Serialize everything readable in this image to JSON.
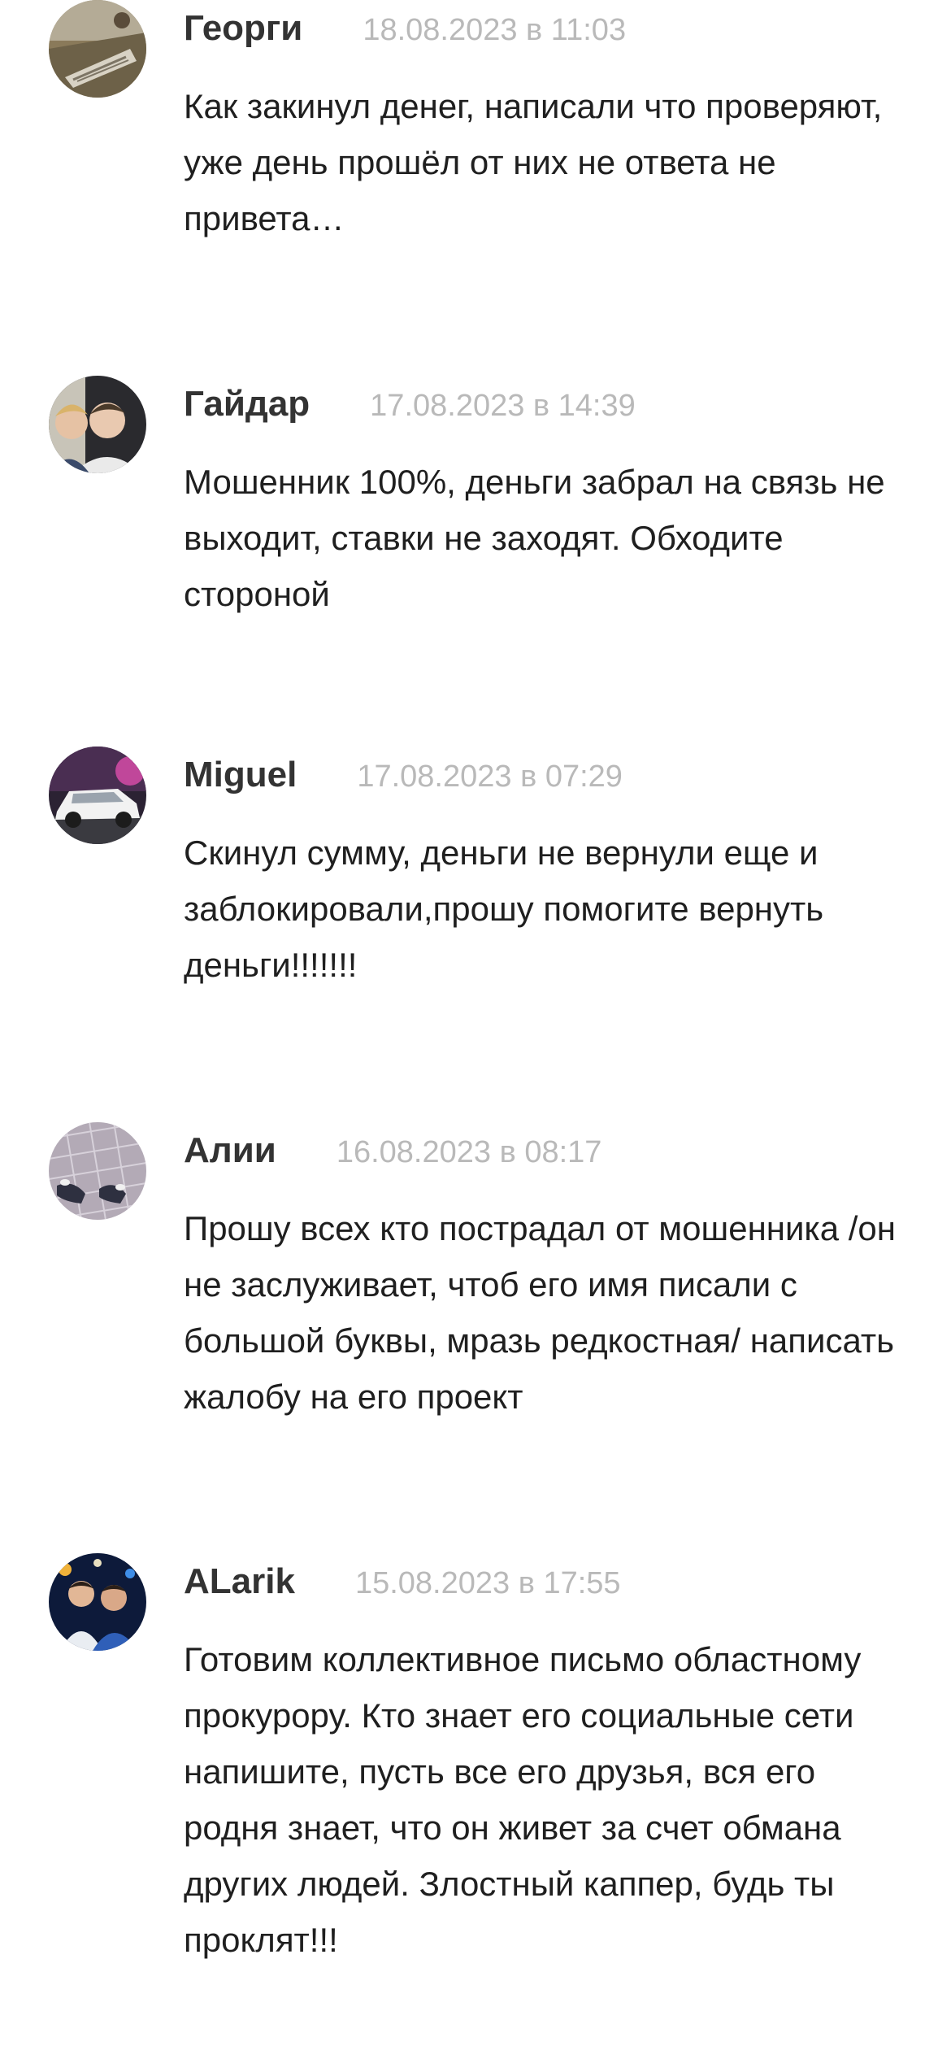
{
  "comments": [
    {
      "author": "Георги",
      "date": "18.08.2023 в 11:03",
      "text": "Как закинул денег, написали что проверяют, уже день прошёл от них не ответа не привета…",
      "avatar_icon": "avatar-photo-icon"
    },
    {
      "author": "Гайдар",
      "date": "17.08.2023 в 14:39",
      "text": "Мошенник 100%, деньги забрал на связь не выходит, ставки не заходят. Обходите стороной",
      "avatar_icon": "avatar-photo-icon"
    },
    {
      "author": "Miguel",
      "date": "17.08.2023 в 07:29",
      "text": "Скинул сумму, деньги не вернули еще и заблокировали,прошу помогите вернуть деньги!!!!!!!",
      "avatar_icon": "avatar-photo-icon"
    },
    {
      "author": "Алии",
      "date": "16.08.2023 в 08:17",
      "text": "Прошу всех кто пострадал от мошенника /он не заслуживает, чтоб его имя писали с большой буквы, мразь редкостная/ написать жалобу на его проект",
      "avatar_icon": "avatar-photo-icon"
    },
    {
      "author": "ALarik",
      "date": "15.08.2023 в 17:55",
      "text": "Готовим коллективное письмо областному прокурору. Кто знает его социальные сети напишите, пусть все его друзья, вся его родня знает, что он живет за счет обмана других людей. Злостный каппер, будь ты проклят!!!",
      "avatar_icon": "avatar-photo-icon"
    }
  ],
  "colors": {
    "author": "#333333",
    "date": "#b9b9b9",
    "text": "#1f1f1f",
    "background": "#ffffff"
  }
}
